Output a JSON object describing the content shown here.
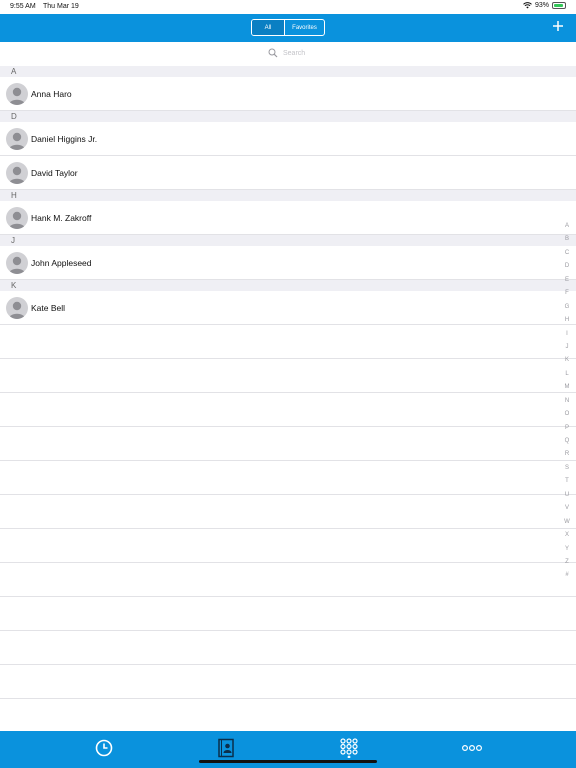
{
  "status_bar": {
    "time": "9:55 AM",
    "date": "Thu Mar 19",
    "battery": "93%",
    "icons": [
      "wifi-icon",
      "battery-icon"
    ]
  },
  "header": {
    "segments": [
      {
        "label": "All",
        "selected": true
      },
      {
        "label": "Favorites",
        "selected": false
      }
    ],
    "add_icon": "plus-icon"
  },
  "search": {
    "placeholder": "Search",
    "icon": "search-icon"
  },
  "sections": [
    {
      "letter": "A",
      "contacts": [
        "Anna Haro"
      ]
    },
    {
      "letter": "D",
      "contacts": [
        "Daniel Higgins Jr.",
        "David Taylor"
      ]
    },
    {
      "letter": "H",
      "contacts": [
        "Hank M. Zakroff"
      ]
    },
    {
      "letter": "J",
      "contacts": [
        "John Appleseed"
      ]
    },
    {
      "letter": "K",
      "contacts": [
        "Kate Bell"
      ]
    }
  ],
  "index_letters": [
    "A",
    "B",
    "C",
    "D",
    "E",
    "F",
    "G",
    "H",
    "I",
    "J",
    "K",
    "L",
    "M",
    "N",
    "O",
    "P",
    "Q",
    "R",
    "S",
    "T",
    "U",
    "V",
    "W",
    "X",
    "Y",
    "Z",
    "#"
  ],
  "tab_bar": {
    "tabs": [
      {
        "icon": "clock-icon",
        "selected": false
      },
      {
        "icon": "contacts-book-icon",
        "selected": true
      },
      {
        "icon": "keypad-icon",
        "selected": false
      },
      {
        "icon": "more-icon",
        "selected": false
      }
    ]
  },
  "colors": {
    "brand_blue": "#0a92dd",
    "section_gray": "#efeff4",
    "battery_green": "#34c759"
  }
}
